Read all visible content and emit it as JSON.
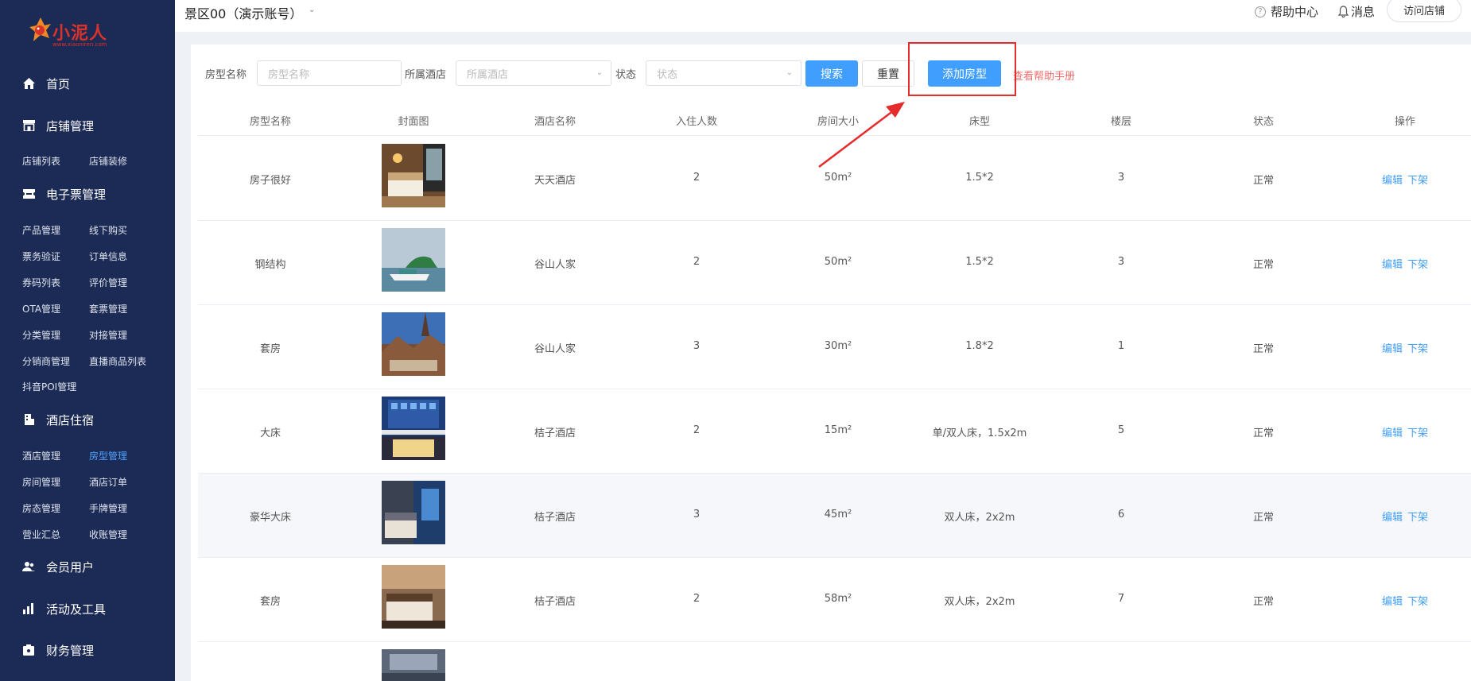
{
  "logo": {
    "text": "小泥人",
    "url_text": "www.xiaoniren.com"
  },
  "sidebar": {
    "sections": [
      {
        "label": "首页",
        "icon": "home-icon"
      },
      {
        "label": "店铺管理",
        "icon": "store-icon"
      },
      {
        "label": "电子票管理",
        "icon": "ticket-icon"
      },
      {
        "label": "酒店住宿",
        "icon": "hotel-icon"
      },
      {
        "label": "会员用户",
        "icon": "users-icon"
      },
      {
        "label": "活动及工具",
        "icon": "tools-icon"
      },
      {
        "label": "财务管理",
        "icon": "finance-icon"
      }
    ],
    "store_items": [
      "店铺列表",
      "店铺装修"
    ],
    "ticket_items": [
      "产品管理",
      "线下购买",
      "票务验证",
      "订单信息",
      "券码列表",
      "评价管理",
      "OTA管理",
      "套票管理",
      "分类管理",
      "对接管理",
      "分销商管理",
      "直播商品列表",
      "抖音POI管理"
    ],
    "hotel_items": [
      "酒店管理",
      "房型管理",
      "房间管理",
      "酒店订单",
      "房态管理",
      "手牌管理",
      "营业汇总",
      "收账管理"
    ],
    "active_item": "房型管理"
  },
  "topbar": {
    "scenic": "景区00（演示账号）",
    "help": "帮助中心",
    "message": "消息",
    "visit_store": "访问店铺"
  },
  "filters": {
    "room_name_label": "房型名称",
    "room_name_placeholder": "房型名称",
    "hotel_label": "所属酒店",
    "hotel_placeholder": "所属酒店",
    "status_label": "状态",
    "status_placeholder": "状态",
    "search": "搜索",
    "reset": "重置",
    "add": "添加房型",
    "help_manual": "查看帮助手册"
  },
  "table": {
    "columns": [
      "房型名称",
      "封面图",
      "酒店名称",
      "入住人数",
      "房间大小",
      "床型",
      "楼层",
      "状态",
      "操作"
    ],
    "rows": [
      {
        "name": "房子很好",
        "hotel": "天天酒店",
        "guests": "2",
        "size": "50m²",
        "bed": "1.5*2",
        "floor": "3",
        "status": "正常"
      },
      {
        "name": "钢结构",
        "hotel": "谷山人家",
        "guests": "2",
        "size": "50m²",
        "bed": "1.5*2",
        "floor": "3",
        "status": "正常"
      },
      {
        "name": "套房",
        "hotel": "谷山人家",
        "guests": "3",
        "size": "30m²",
        "bed": "1.8*2",
        "floor": "1",
        "status": "正常"
      },
      {
        "name": "大床",
        "hotel": "桔子酒店",
        "guests": "2",
        "size": "15m²",
        "bed": "单/双人床，1.5x2m",
        "floor": "5",
        "status": "正常"
      },
      {
        "name": "豪华大床",
        "hotel": "桔子酒店",
        "guests": "3",
        "size": "45m²",
        "bed": "双人床，2x2m",
        "floor": "6",
        "status": "正常"
      },
      {
        "name": "套房",
        "hotel": "桔子酒店",
        "guests": "2",
        "size": "58m²",
        "bed": "双人床，2x2m",
        "floor": "7",
        "status": "正常"
      }
    ],
    "op_edit": "编辑",
    "op_offline": "下架"
  }
}
